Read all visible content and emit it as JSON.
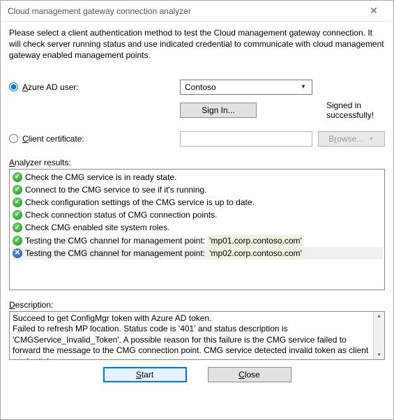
{
  "window": {
    "title": "Cloud management gateway connection analyzer"
  },
  "intro": "Please select a client authentication method to test the Cloud management gateway connection. It will check server running status and use indicated credential to communicate with cloud management gateway enabled management points.",
  "auth": {
    "azure_label_prefix": "A",
    "azure_label_rest": "zure AD user:",
    "azure_selected": true,
    "tenant_value": "Contoso",
    "signin_prefix": "Si",
    "signin_u": "g",
    "signin_rest": "n In...",
    "signin_status": "Signed in successfully!",
    "cert_label_prefix": "C",
    "cert_label_rest": "lient certificate:",
    "cert_selected": false,
    "browse_prefix": "B",
    "browse_u": "r",
    "browse_rest": "owse..."
  },
  "results": {
    "label": "Analyzer results:",
    "items": [
      {
        "status": "ok",
        "text": "Check the CMG service is in ready state.",
        "mp": ""
      },
      {
        "status": "ok",
        "text": "Connect to the CMG service to see if it's running.",
        "mp": ""
      },
      {
        "status": "ok",
        "text": "Check configuration settings of the CMG service is up to date.",
        "mp": ""
      },
      {
        "status": "ok",
        "text": "Check connection status of CMG connection points.",
        "mp": ""
      },
      {
        "status": "ok",
        "text": "Check CMG enabled site system roles.",
        "mp": ""
      },
      {
        "status": "ok",
        "text": "Testing the CMG channel for management point:",
        "mp": "'mp01.corp.contoso.com'"
      },
      {
        "status": "err",
        "text": "Testing the CMG channel for management point:",
        "mp": "'mp02.corp.contoso.com'",
        "selected": true
      }
    ]
  },
  "description": {
    "label_prefix": "D",
    "label_rest": "escription:",
    "text": "Succeed to get ConfigMgr token with Azure AD token.\nFailed to refresh MP location. Status code is '401' and status description is 'CMGService_Invalid_Token'. A possible reason for this failure is the CMG service failed to forward the message to the CMG connection point. CMG service detected invalid token as client credential."
  },
  "footer": {
    "start_u": "S",
    "start_rest": "tart",
    "close_prefix": "",
    "close_u": "C",
    "close_rest": "lose"
  }
}
